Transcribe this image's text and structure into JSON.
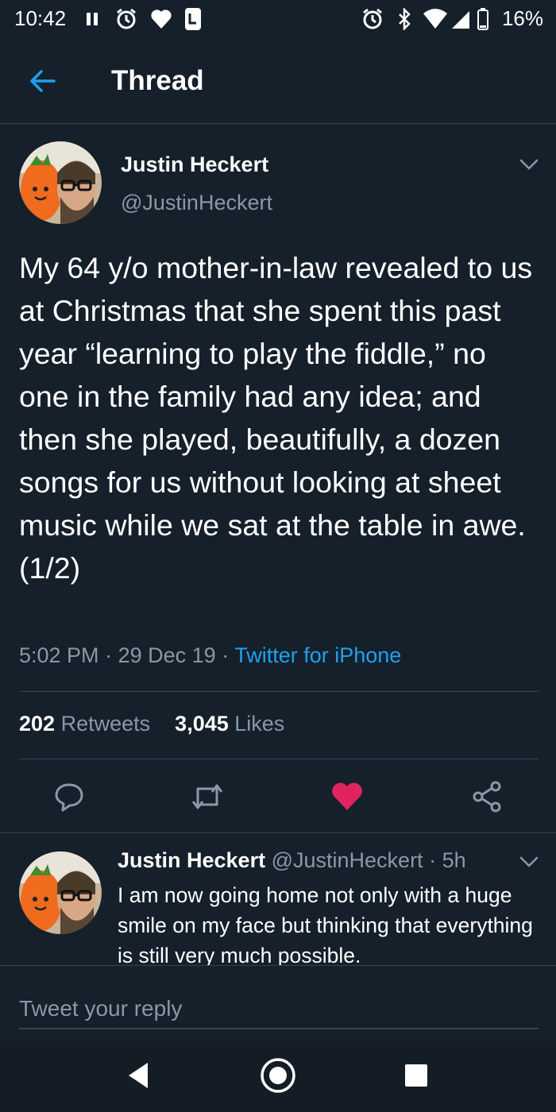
{
  "status_bar": {
    "time": "10:42",
    "battery": "16%"
  },
  "header": {
    "title": "Thread"
  },
  "main_tweet": {
    "author_name": "Justin Heckert",
    "author_handle": "@JustinHeckert",
    "text": "My 64 y/o mother-in-law revealed to us at Christmas that she spent this past year “learning to play the fiddle,” no one in the family had any idea; and then she played, beautifully, a dozen songs for us without looking at sheet music while we sat at the table in awe. (1/2)",
    "time": "5:02 PM",
    "separator": "·",
    "date": "29 Dec 19",
    "source": "Twitter for iPhone",
    "retweets_count": "202",
    "retweets_label": "Retweets",
    "likes_count": "3,045",
    "likes_label": "Likes",
    "liked": true
  },
  "reply_tweet": {
    "author_name": "Justin Heckert",
    "author_handle": "@JustinHeckert",
    "age": "5h",
    "text": "I am now going home not only with a huge smile on my face but thinking that everything is still very much possible."
  },
  "compose": {
    "placeholder": "Tweet your reply"
  },
  "colors": {
    "background": "#15202b",
    "accent": "#1da1f2",
    "like": "#e0245e",
    "muted": "#8899a6",
    "divider": "#38444d"
  }
}
